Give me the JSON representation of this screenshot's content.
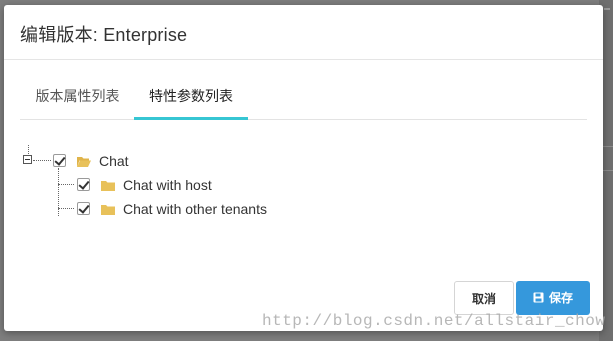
{
  "modal": {
    "title": "编辑版本: Enterprise",
    "tabs": [
      {
        "label": "版本属性列表",
        "active": false
      },
      {
        "label": "特性参数列表",
        "active": true
      }
    ],
    "tree": {
      "root": {
        "label": "Chat",
        "checked": true,
        "expanded": true,
        "icon": "folder-open-icon"
      },
      "children": [
        {
          "label": "Chat with host",
          "checked": true,
          "icon": "folder-icon"
        },
        {
          "label": "Chat with other tenants",
          "checked": true,
          "icon": "folder-icon"
        }
      ]
    },
    "buttons": {
      "cancel_label": "取消",
      "save_label": "保存"
    }
  },
  "watermark": "http://blog.csdn.net/allstair_chow",
  "colors": {
    "accent_tab": "#36c6d3",
    "primary_button": "#3598dc",
    "folder": "#e8c15a"
  }
}
